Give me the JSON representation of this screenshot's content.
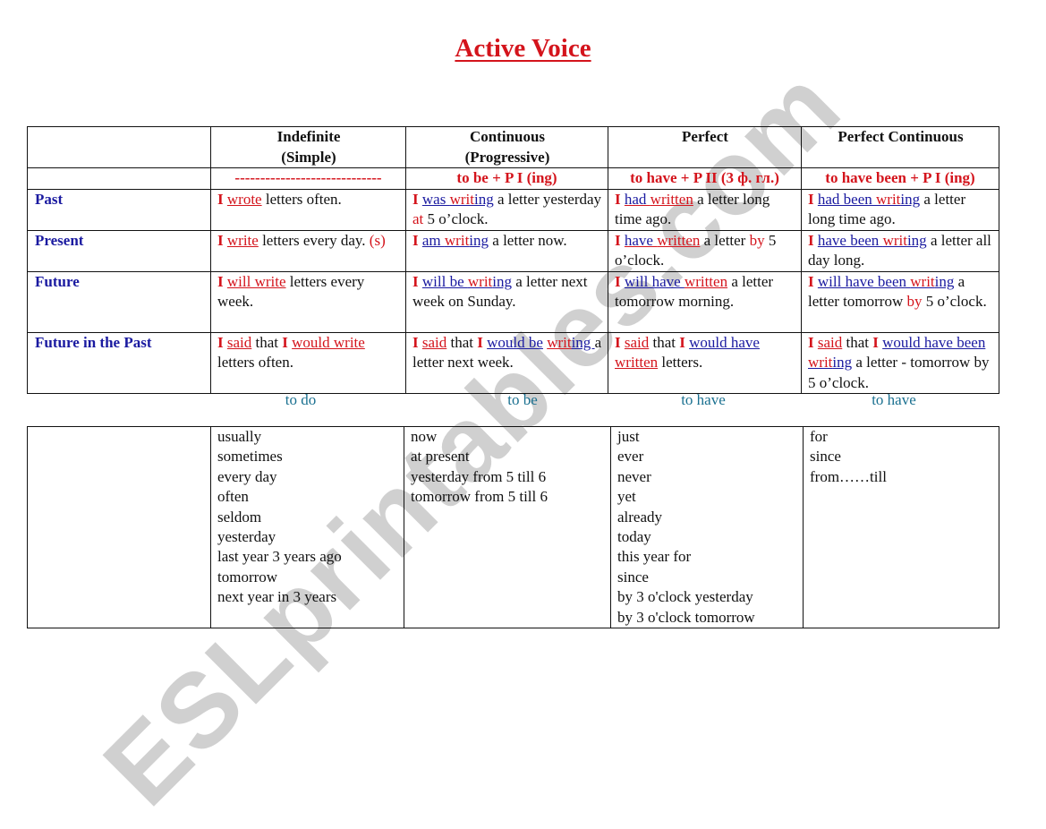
{
  "title": "Active Voice",
  "grammar_table": {
    "headers": [
      {
        "line1": "",
        "line2": ""
      },
      {
        "line1": "Indefinite",
        "line2": "(Simple)"
      },
      {
        "line1": "Continuous",
        "line2": "(Progressive)"
      },
      {
        "line1": "Perfect",
        "line2": ""
      },
      {
        "line1": "Perfect Continuous",
        "line2": ""
      }
    ],
    "formulas": [
      "",
      "-----------------------------",
      "to be + P I (ing)",
      "to have + P II (3 ф. гл.)",
      "to have been + P I (ing)"
    ],
    "rows": [
      {
        "label": "Past",
        "cells": [
          [
            {
              "t": "I",
              "s": "rb"
            },
            {
              "t": " "
            },
            {
              "t": "wrote",
              "s": "r ur"
            },
            {
              "t": " letters often."
            }
          ],
          [
            {
              "t": "I",
              "s": "rb"
            },
            {
              "t": " "
            },
            {
              "t": "was ",
              "s": "b ub"
            },
            {
              "t": "writ",
              "s": "r ub"
            },
            {
              "t": "ing",
              "s": "b ub"
            },
            {
              "t": " a letter yesterday "
            },
            {
              "t": "at",
              "s": "r"
            },
            {
              "t": " 5 o’clock."
            }
          ],
          [
            {
              "t": "I",
              "s": "rb"
            },
            {
              "t": " "
            },
            {
              "t": "had ",
              "s": "b ur"
            },
            {
              "t": "written",
              "s": "r ur"
            },
            {
              "t": " a letter long time ago."
            }
          ],
          [
            {
              "t": "I",
              "s": "rb"
            },
            {
              "t": " "
            },
            {
              "t": "had been ",
              "s": "b ub"
            },
            {
              "t": "writ",
              "s": "r ub"
            },
            {
              "t": "ing",
              "s": "b ub"
            },
            {
              "t": " a letter long time ago."
            }
          ]
        ]
      },
      {
        "label": "Present",
        "cells": [
          [
            {
              "t": "I",
              "s": "rb"
            },
            {
              "t": " "
            },
            {
              "t": "write",
              "s": "r ur"
            },
            {
              "t": " letters every day. "
            },
            {
              "t": "(s)",
              "s": "r"
            }
          ],
          [
            {
              "t": "I",
              "s": "rb"
            },
            {
              "t": " "
            },
            {
              "t": "am ",
              "s": "b ub"
            },
            {
              "t": "writ",
              "s": "r ub"
            },
            {
              "t": "ing",
              "s": "b ub"
            },
            {
              "t": " a letter now."
            }
          ],
          [
            {
              "t": "I",
              "s": "rb"
            },
            {
              "t": " "
            },
            {
              "t": "have ",
              "s": "b ur"
            },
            {
              "t": "written",
              "s": "r ur"
            },
            {
              "t": " a letter "
            },
            {
              "t": "by",
              "s": "r"
            },
            {
              "t": " 5 o’clock."
            }
          ],
          [
            {
              "t": "I",
              "s": "rb"
            },
            {
              "t": " "
            },
            {
              "t": "have been ",
              "s": "b ub"
            },
            {
              "t": "writ",
              "s": "r ub"
            },
            {
              "t": "ing",
              "s": "b ub"
            },
            {
              "t": " a letter all day long."
            }
          ]
        ]
      },
      {
        "label": "Future",
        "cells": [
          [
            {
              "t": "I",
              "s": "rb"
            },
            {
              "t": " "
            },
            {
              "t": "will write",
              "s": "r ur"
            },
            {
              "t": " letters every week."
            }
          ],
          [
            {
              "t": "I",
              "s": "rb"
            },
            {
              "t": " "
            },
            {
              "t": "will be ",
              "s": "b ub"
            },
            {
              "t": "writ",
              "s": "r ub"
            },
            {
              "t": "ing",
              "s": "b ub"
            },
            {
              "t": " a letter next week on Sunday."
            }
          ],
          [
            {
              "t": "I",
              "s": "rb"
            },
            {
              "t": " "
            },
            {
              "t": "will have ",
              "s": "b ub"
            },
            {
              "t": "written",
              "s": "r ur"
            },
            {
              "t": " a letter tomorrow morning."
            }
          ],
          [
            {
              "t": "I",
              "s": "rb"
            },
            {
              "t": " "
            },
            {
              "t": "will have been ",
              "s": "b ub"
            },
            {
              "t": "writ",
              "s": "r ub"
            },
            {
              "t": "ing",
              "s": "b ub"
            },
            {
              "t": " a letter tomorrow "
            },
            {
              "t": "by",
              "s": "r"
            },
            {
              "t": " 5 o’clock."
            }
          ]
        ]
      },
      {
        "label": "Future in the Past",
        "cells": [
          [
            {
              "t": "I",
              "s": "rb"
            },
            {
              "t": " "
            },
            {
              "t": "said",
              "s": "r ur"
            },
            {
              "t": " that "
            },
            {
              "t": "I",
              "s": "rb"
            },
            {
              "t": " "
            },
            {
              "t": "would write",
              "s": "r ur"
            },
            {
              "t": " letters often."
            }
          ],
          [
            {
              "t": "I",
              "s": "rb"
            },
            {
              "t": " "
            },
            {
              "t": "said",
              "s": "r ur"
            },
            {
              "t": " that "
            },
            {
              "t": "I",
              "s": "rb"
            },
            {
              "t": " "
            },
            {
              "t": "would be",
              "s": "b ub"
            },
            {
              "t": " "
            },
            {
              "t": "writ",
              "s": "r ur"
            },
            {
              "t": "ing ",
              "s": "b ub"
            },
            {
              "t": "a letter next week."
            }
          ],
          [
            {
              "t": "I",
              "s": "rb"
            },
            {
              "t": " "
            },
            {
              "t": "said",
              "s": "r ur"
            },
            {
              "t": " that "
            },
            {
              "t": "I",
              "s": "rb"
            },
            {
              "t": " "
            },
            {
              "t": "would have",
              "s": "b ub"
            },
            {
              "t": " "
            },
            {
              "t": "written",
              "s": "r ur"
            },
            {
              "t": " letters."
            }
          ],
          [
            {
              "t": "I",
              "s": "rb"
            },
            {
              "t": " "
            },
            {
              "t": "said",
              "s": "r ur"
            },
            {
              "t": " that "
            },
            {
              "t": "I",
              "s": "rb"
            },
            {
              "t": " "
            },
            {
              "t": "would have been ",
              "s": "b ub"
            },
            {
              "t": "writ",
              "s": "r ub"
            },
            {
              "t": "ing",
              "s": "b ub"
            },
            {
              "t": " a letter - tomorrow by 5 o’clock."
            }
          ]
        ]
      }
    ]
  },
  "auxiliaries": [
    "to do",
    "to be",
    "to have",
    "to have"
  ],
  "markers_table": {
    "columns": [
      [],
      [
        "usually",
        "sometimes",
        "every day",
        "often",
        "seldom",
        "yesterday",
        "last year 3 years ago",
        "tomorrow",
        "next year in 3 years"
      ],
      [
        "now",
        "at present",
        "yesterday from 5 till 6",
        "tomorrow from 5 till 6"
      ],
      [
        "just",
        "ever",
        "never",
        "yet",
        "already",
        "today",
        "this year for",
        "since",
        "by 3 o'clock yesterday",
        "by 3 o'clock tomorrow"
      ],
      [
        "for",
        "since",
        "from……till"
      ]
    ]
  },
  "watermark": "ESLprintables.com",
  "colors": {
    "red": "#d4141c",
    "blue": "#1a1aa0",
    "teal": "#1a7090"
  }
}
